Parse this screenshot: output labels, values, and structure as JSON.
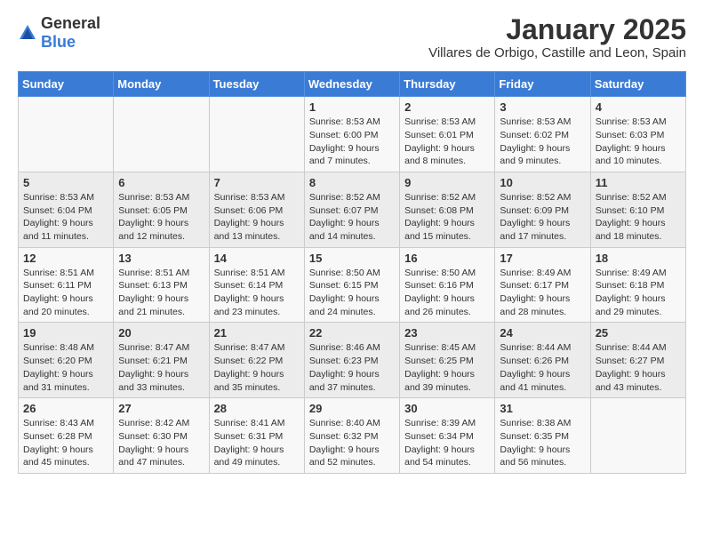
{
  "logo": {
    "general": "General",
    "blue": "Blue"
  },
  "title": "January 2025",
  "subtitle": "Villares de Orbigo, Castille and Leon, Spain",
  "days_header": [
    "Sunday",
    "Monday",
    "Tuesday",
    "Wednesday",
    "Thursday",
    "Friday",
    "Saturday"
  ],
  "weeks": [
    [
      {
        "day": "",
        "detail": ""
      },
      {
        "day": "",
        "detail": ""
      },
      {
        "day": "",
        "detail": ""
      },
      {
        "day": "1",
        "detail": "Sunrise: 8:53 AM\nSunset: 6:00 PM\nDaylight: 9 hours and 7 minutes."
      },
      {
        "day": "2",
        "detail": "Sunrise: 8:53 AM\nSunset: 6:01 PM\nDaylight: 9 hours and 8 minutes."
      },
      {
        "day": "3",
        "detail": "Sunrise: 8:53 AM\nSunset: 6:02 PM\nDaylight: 9 hours and 9 minutes."
      },
      {
        "day": "4",
        "detail": "Sunrise: 8:53 AM\nSunset: 6:03 PM\nDaylight: 9 hours and 10 minutes."
      }
    ],
    [
      {
        "day": "5",
        "detail": "Sunrise: 8:53 AM\nSunset: 6:04 PM\nDaylight: 9 hours and 11 minutes."
      },
      {
        "day": "6",
        "detail": "Sunrise: 8:53 AM\nSunset: 6:05 PM\nDaylight: 9 hours and 12 minutes."
      },
      {
        "day": "7",
        "detail": "Sunrise: 8:53 AM\nSunset: 6:06 PM\nDaylight: 9 hours and 13 minutes."
      },
      {
        "day": "8",
        "detail": "Sunrise: 8:52 AM\nSunset: 6:07 PM\nDaylight: 9 hours and 14 minutes."
      },
      {
        "day": "9",
        "detail": "Sunrise: 8:52 AM\nSunset: 6:08 PM\nDaylight: 9 hours and 15 minutes."
      },
      {
        "day": "10",
        "detail": "Sunrise: 8:52 AM\nSunset: 6:09 PM\nDaylight: 9 hours and 17 minutes."
      },
      {
        "day": "11",
        "detail": "Sunrise: 8:52 AM\nSunset: 6:10 PM\nDaylight: 9 hours and 18 minutes."
      }
    ],
    [
      {
        "day": "12",
        "detail": "Sunrise: 8:51 AM\nSunset: 6:11 PM\nDaylight: 9 hours and 20 minutes."
      },
      {
        "day": "13",
        "detail": "Sunrise: 8:51 AM\nSunset: 6:13 PM\nDaylight: 9 hours and 21 minutes."
      },
      {
        "day": "14",
        "detail": "Sunrise: 8:51 AM\nSunset: 6:14 PM\nDaylight: 9 hours and 23 minutes."
      },
      {
        "day": "15",
        "detail": "Sunrise: 8:50 AM\nSunset: 6:15 PM\nDaylight: 9 hours and 24 minutes."
      },
      {
        "day": "16",
        "detail": "Sunrise: 8:50 AM\nSunset: 6:16 PM\nDaylight: 9 hours and 26 minutes."
      },
      {
        "day": "17",
        "detail": "Sunrise: 8:49 AM\nSunset: 6:17 PM\nDaylight: 9 hours and 28 minutes."
      },
      {
        "day": "18",
        "detail": "Sunrise: 8:49 AM\nSunset: 6:18 PM\nDaylight: 9 hours and 29 minutes."
      }
    ],
    [
      {
        "day": "19",
        "detail": "Sunrise: 8:48 AM\nSunset: 6:20 PM\nDaylight: 9 hours and 31 minutes."
      },
      {
        "day": "20",
        "detail": "Sunrise: 8:47 AM\nSunset: 6:21 PM\nDaylight: 9 hours and 33 minutes."
      },
      {
        "day": "21",
        "detail": "Sunrise: 8:47 AM\nSunset: 6:22 PM\nDaylight: 9 hours and 35 minutes."
      },
      {
        "day": "22",
        "detail": "Sunrise: 8:46 AM\nSunset: 6:23 PM\nDaylight: 9 hours and 37 minutes."
      },
      {
        "day": "23",
        "detail": "Sunrise: 8:45 AM\nSunset: 6:25 PM\nDaylight: 9 hours and 39 minutes."
      },
      {
        "day": "24",
        "detail": "Sunrise: 8:44 AM\nSunset: 6:26 PM\nDaylight: 9 hours and 41 minutes."
      },
      {
        "day": "25",
        "detail": "Sunrise: 8:44 AM\nSunset: 6:27 PM\nDaylight: 9 hours and 43 minutes."
      }
    ],
    [
      {
        "day": "26",
        "detail": "Sunrise: 8:43 AM\nSunset: 6:28 PM\nDaylight: 9 hours and 45 minutes."
      },
      {
        "day": "27",
        "detail": "Sunrise: 8:42 AM\nSunset: 6:30 PM\nDaylight: 9 hours and 47 minutes."
      },
      {
        "day": "28",
        "detail": "Sunrise: 8:41 AM\nSunset: 6:31 PM\nDaylight: 9 hours and 49 minutes."
      },
      {
        "day": "29",
        "detail": "Sunrise: 8:40 AM\nSunset: 6:32 PM\nDaylight: 9 hours and 52 minutes."
      },
      {
        "day": "30",
        "detail": "Sunrise: 8:39 AM\nSunset: 6:34 PM\nDaylight: 9 hours and 54 minutes."
      },
      {
        "day": "31",
        "detail": "Sunrise: 8:38 AM\nSunset: 6:35 PM\nDaylight: 9 hours and 56 minutes."
      },
      {
        "day": "",
        "detail": ""
      }
    ]
  ]
}
